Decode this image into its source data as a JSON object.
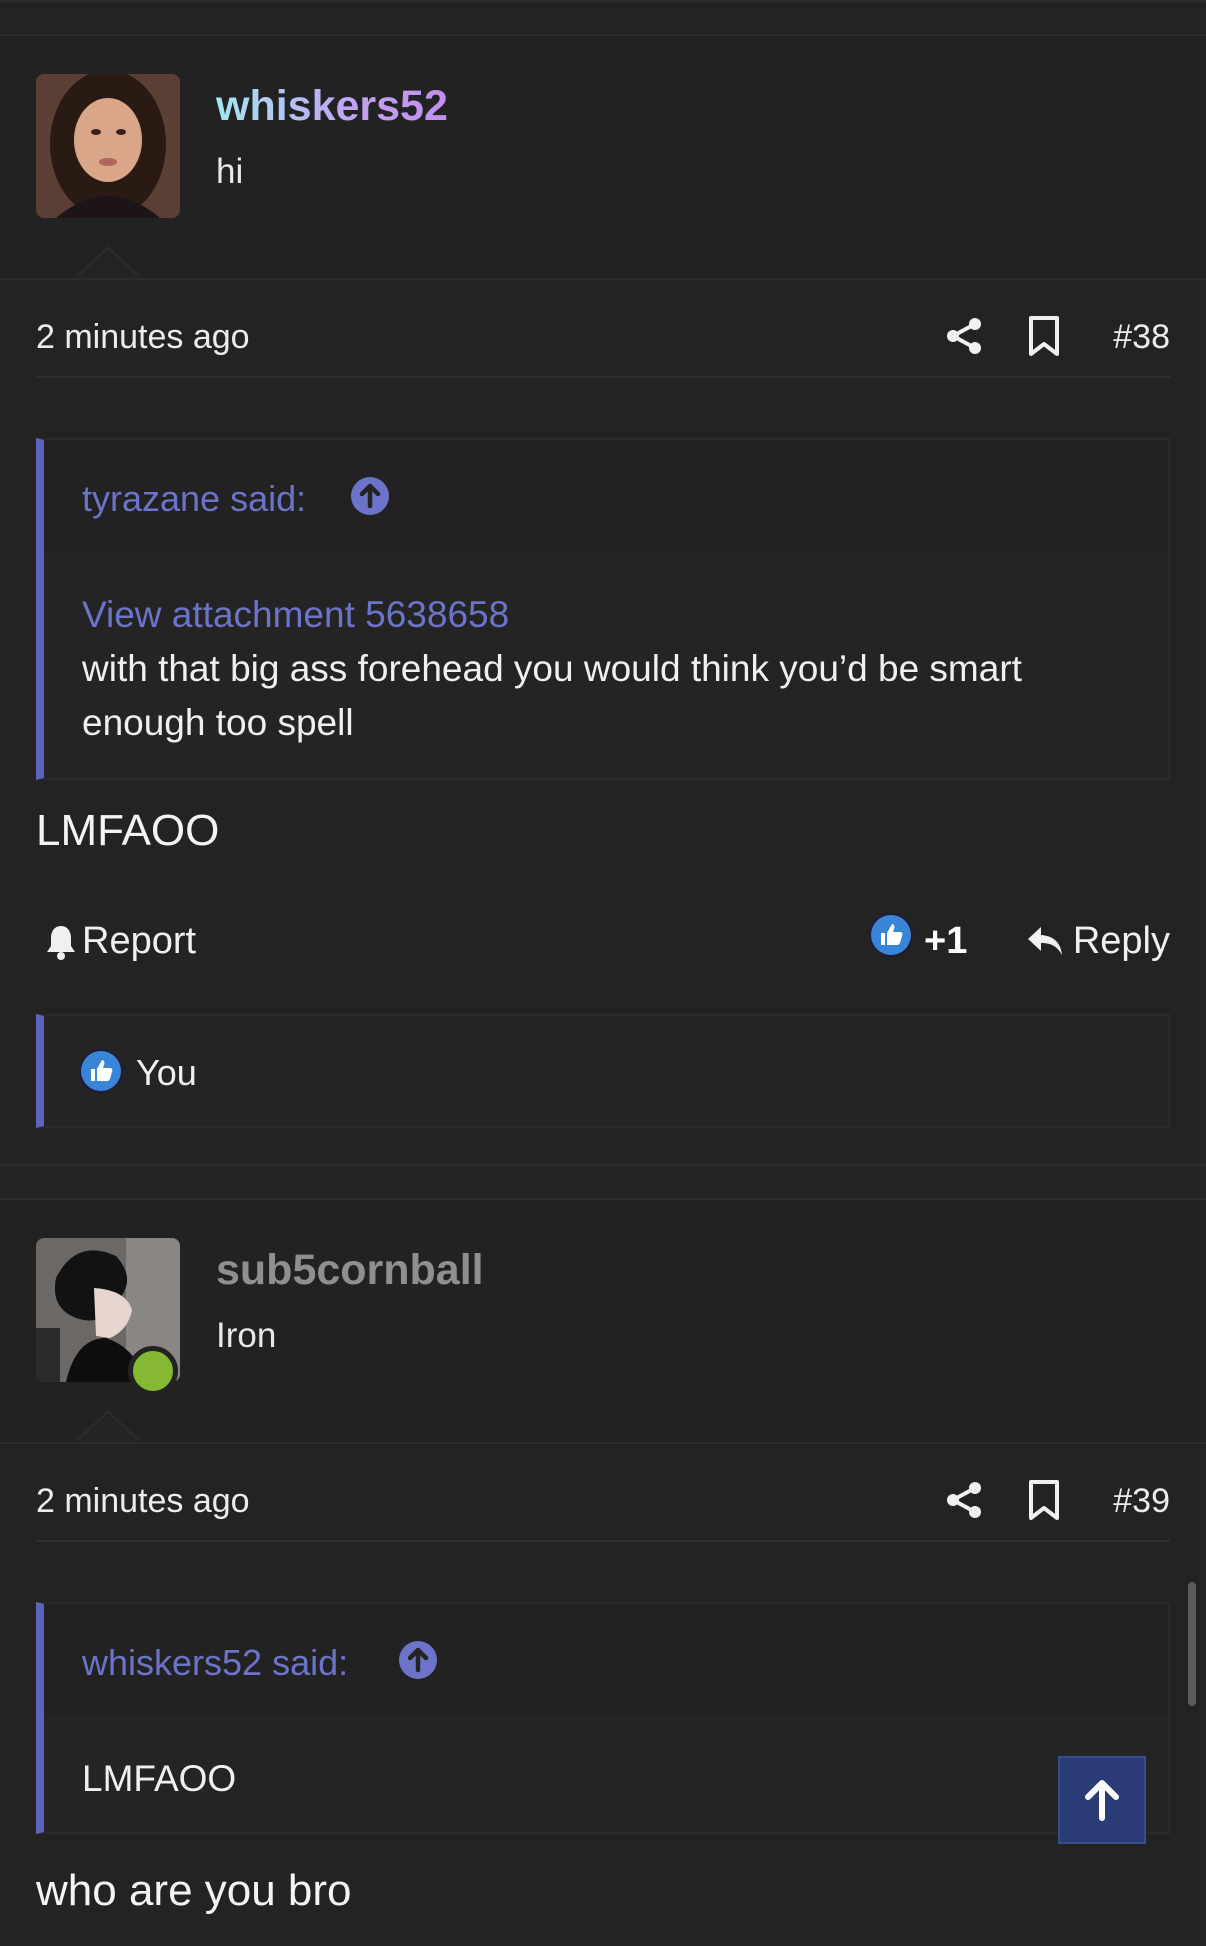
{
  "posts": [
    {
      "username": "whiskers52",
      "user_title": "hi",
      "avatar": "avatar-portrait-girl",
      "timestamp": "2 minutes ago",
      "post_number": "#38",
      "quote": {
        "author_label": "tyrazane said:",
        "attachment_link": "View attachment 5638658",
        "text": "with that big ass forehead you would think you’d be smart enough too spell"
      },
      "message": "LMFAOO",
      "actions": {
        "report_label": "Report",
        "like_count": "+1",
        "reply_label": "Reply"
      },
      "reactions": {
        "users": "You"
      }
    },
    {
      "username": "sub5cornball",
      "user_title": "Iron",
      "avatar": "avatar-dark-hair-profile",
      "online": true,
      "timestamp": "2 minutes ago",
      "post_number": "#39",
      "quote": {
        "author_label": "whiskers52 said:",
        "text": "LMFAOO"
      },
      "message": "who are you bro"
    }
  ],
  "icons": {
    "share": "share-icon",
    "bookmark": "bookmark-icon",
    "goto_quote": "arrow-up-circle-icon",
    "report": "bell-icon",
    "like": "thumbs-up-icon",
    "reply": "reply-arrow-icon",
    "scroll_top": "arrow-up-icon"
  },
  "colors": {
    "background": "#232323",
    "accent": "#5b63bd",
    "link": "#6b74c8",
    "online": "#85b934",
    "top_button": "#2a3b78"
  }
}
